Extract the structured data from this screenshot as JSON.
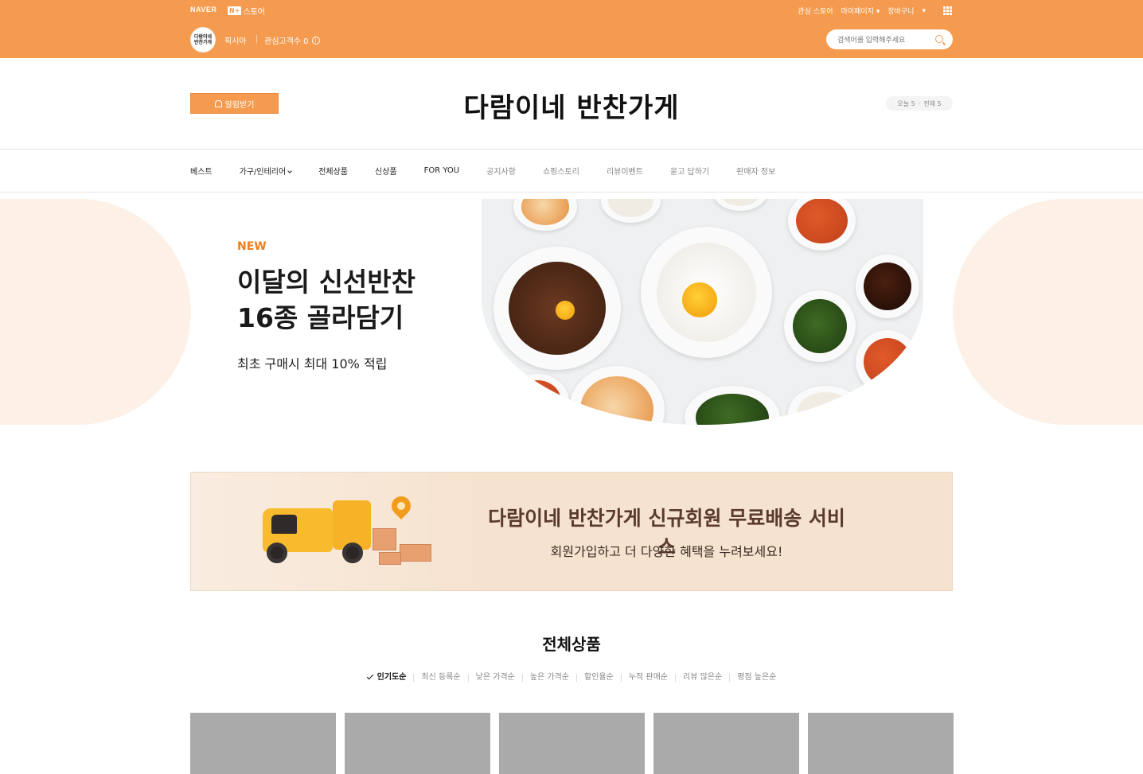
{
  "topbar": {
    "naver": "NAVER",
    "nstore_box": "N+",
    "nstore": "스토어",
    "links": [
      "관심 스토어",
      "마이페이지 ▾",
      "장바구니",
      "▾"
    ]
  },
  "storebar": {
    "logo_line1": "다람이네",
    "logo_line2": "반찬가게",
    "store_name": "픽시아",
    "fans": "관심고객수 0",
    "search_placeholder": "검색어를 입력해주세요"
  },
  "header": {
    "alarm_label": "알림받기",
    "store_title": "다람이네 반찬가게",
    "visit_today": "오늘 5",
    "visit_total": "전체 5"
  },
  "nav": {
    "items": [
      "베스트",
      "가구/인테리어",
      "전체상품",
      "신상품",
      "FOR YOU",
      "공지사항",
      "쇼핑스토리",
      "리뷰이벤트",
      "묻고 답하기",
      "판매자 정보"
    ]
  },
  "hero": {
    "badge": "NEW",
    "headline": "이달의 신선반찬\n16종 골라담기",
    "sub": "최초 구매시 최대 10% 적립"
  },
  "promo": {
    "title": "다람이네 반찬가게 신규회원 무료배송 서비스",
    "sub": "회원가입하고 더 다양한 혜택을 누려보세요!"
  },
  "products": {
    "title": "전체상품",
    "sorts": [
      "인기도순",
      "최신 등록순",
      "낮은 가격순",
      "높은 가격순",
      "할인율순",
      "누적 판매순",
      "리뷰 많은순",
      "평점 높은순"
    ],
    "active_sort": "인기도순"
  },
  "colors": {
    "brand": "#f59b4f",
    "hero_bg": "#fdf1e7",
    "promo_bg": "#f6e3cf",
    "badge": "#f07e1c"
  }
}
